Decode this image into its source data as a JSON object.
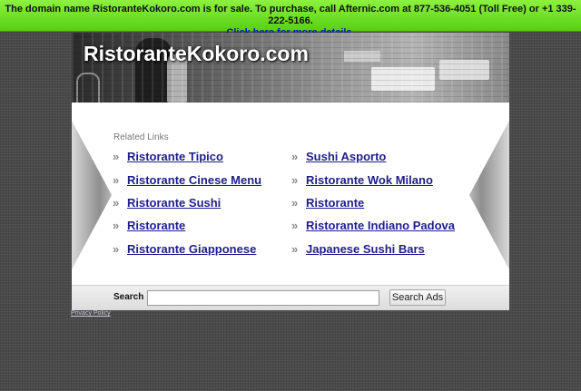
{
  "banner": {
    "text": "The domain name RistoranteKokoro.com is for sale. To purchase, call Afternic.com at 877-536-4051 (Toll Free) or +1 339-222-5166.",
    "link": "Click here for more details."
  },
  "header": {
    "site_title": "RistoranteKokoro.com"
  },
  "related": {
    "heading": "Related Links",
    "left": [
      {
        "label": "Ristorante Tipico"
      },
      {
        "label": "Ristorante Cinese Menu"
      },
      {
        "label": "Ristorante Sushi"
      },
      {
        "label": "Ristorante"
      },
      {
        "label": "Ristorante Giapponese"
      }
    ],
    "right": [
      {
        "label": "Sushi Asporto"
      },
      {
        "label": "Ristorante Wok Milano"
      },
      {
        "label": "Ristorante"
      },
      {
        "label": "Ristorante Indiano Padova"
      },
      {
        "label": "Japanese Sushi Bars"
      }
    ],
    "bullet": "»"
  },
  "search": {
    "label": "Search",
    "value": "",
    "placeholder": "",
    "button": "Search Ads"
  },
  "footer": {
    "privacy": "Privacy Policy"
  },
  "colors": {
    "banner": "#58cf12",
    "link": "#1e1e8a",
    "background": "#4a4a4a"
  }
}
